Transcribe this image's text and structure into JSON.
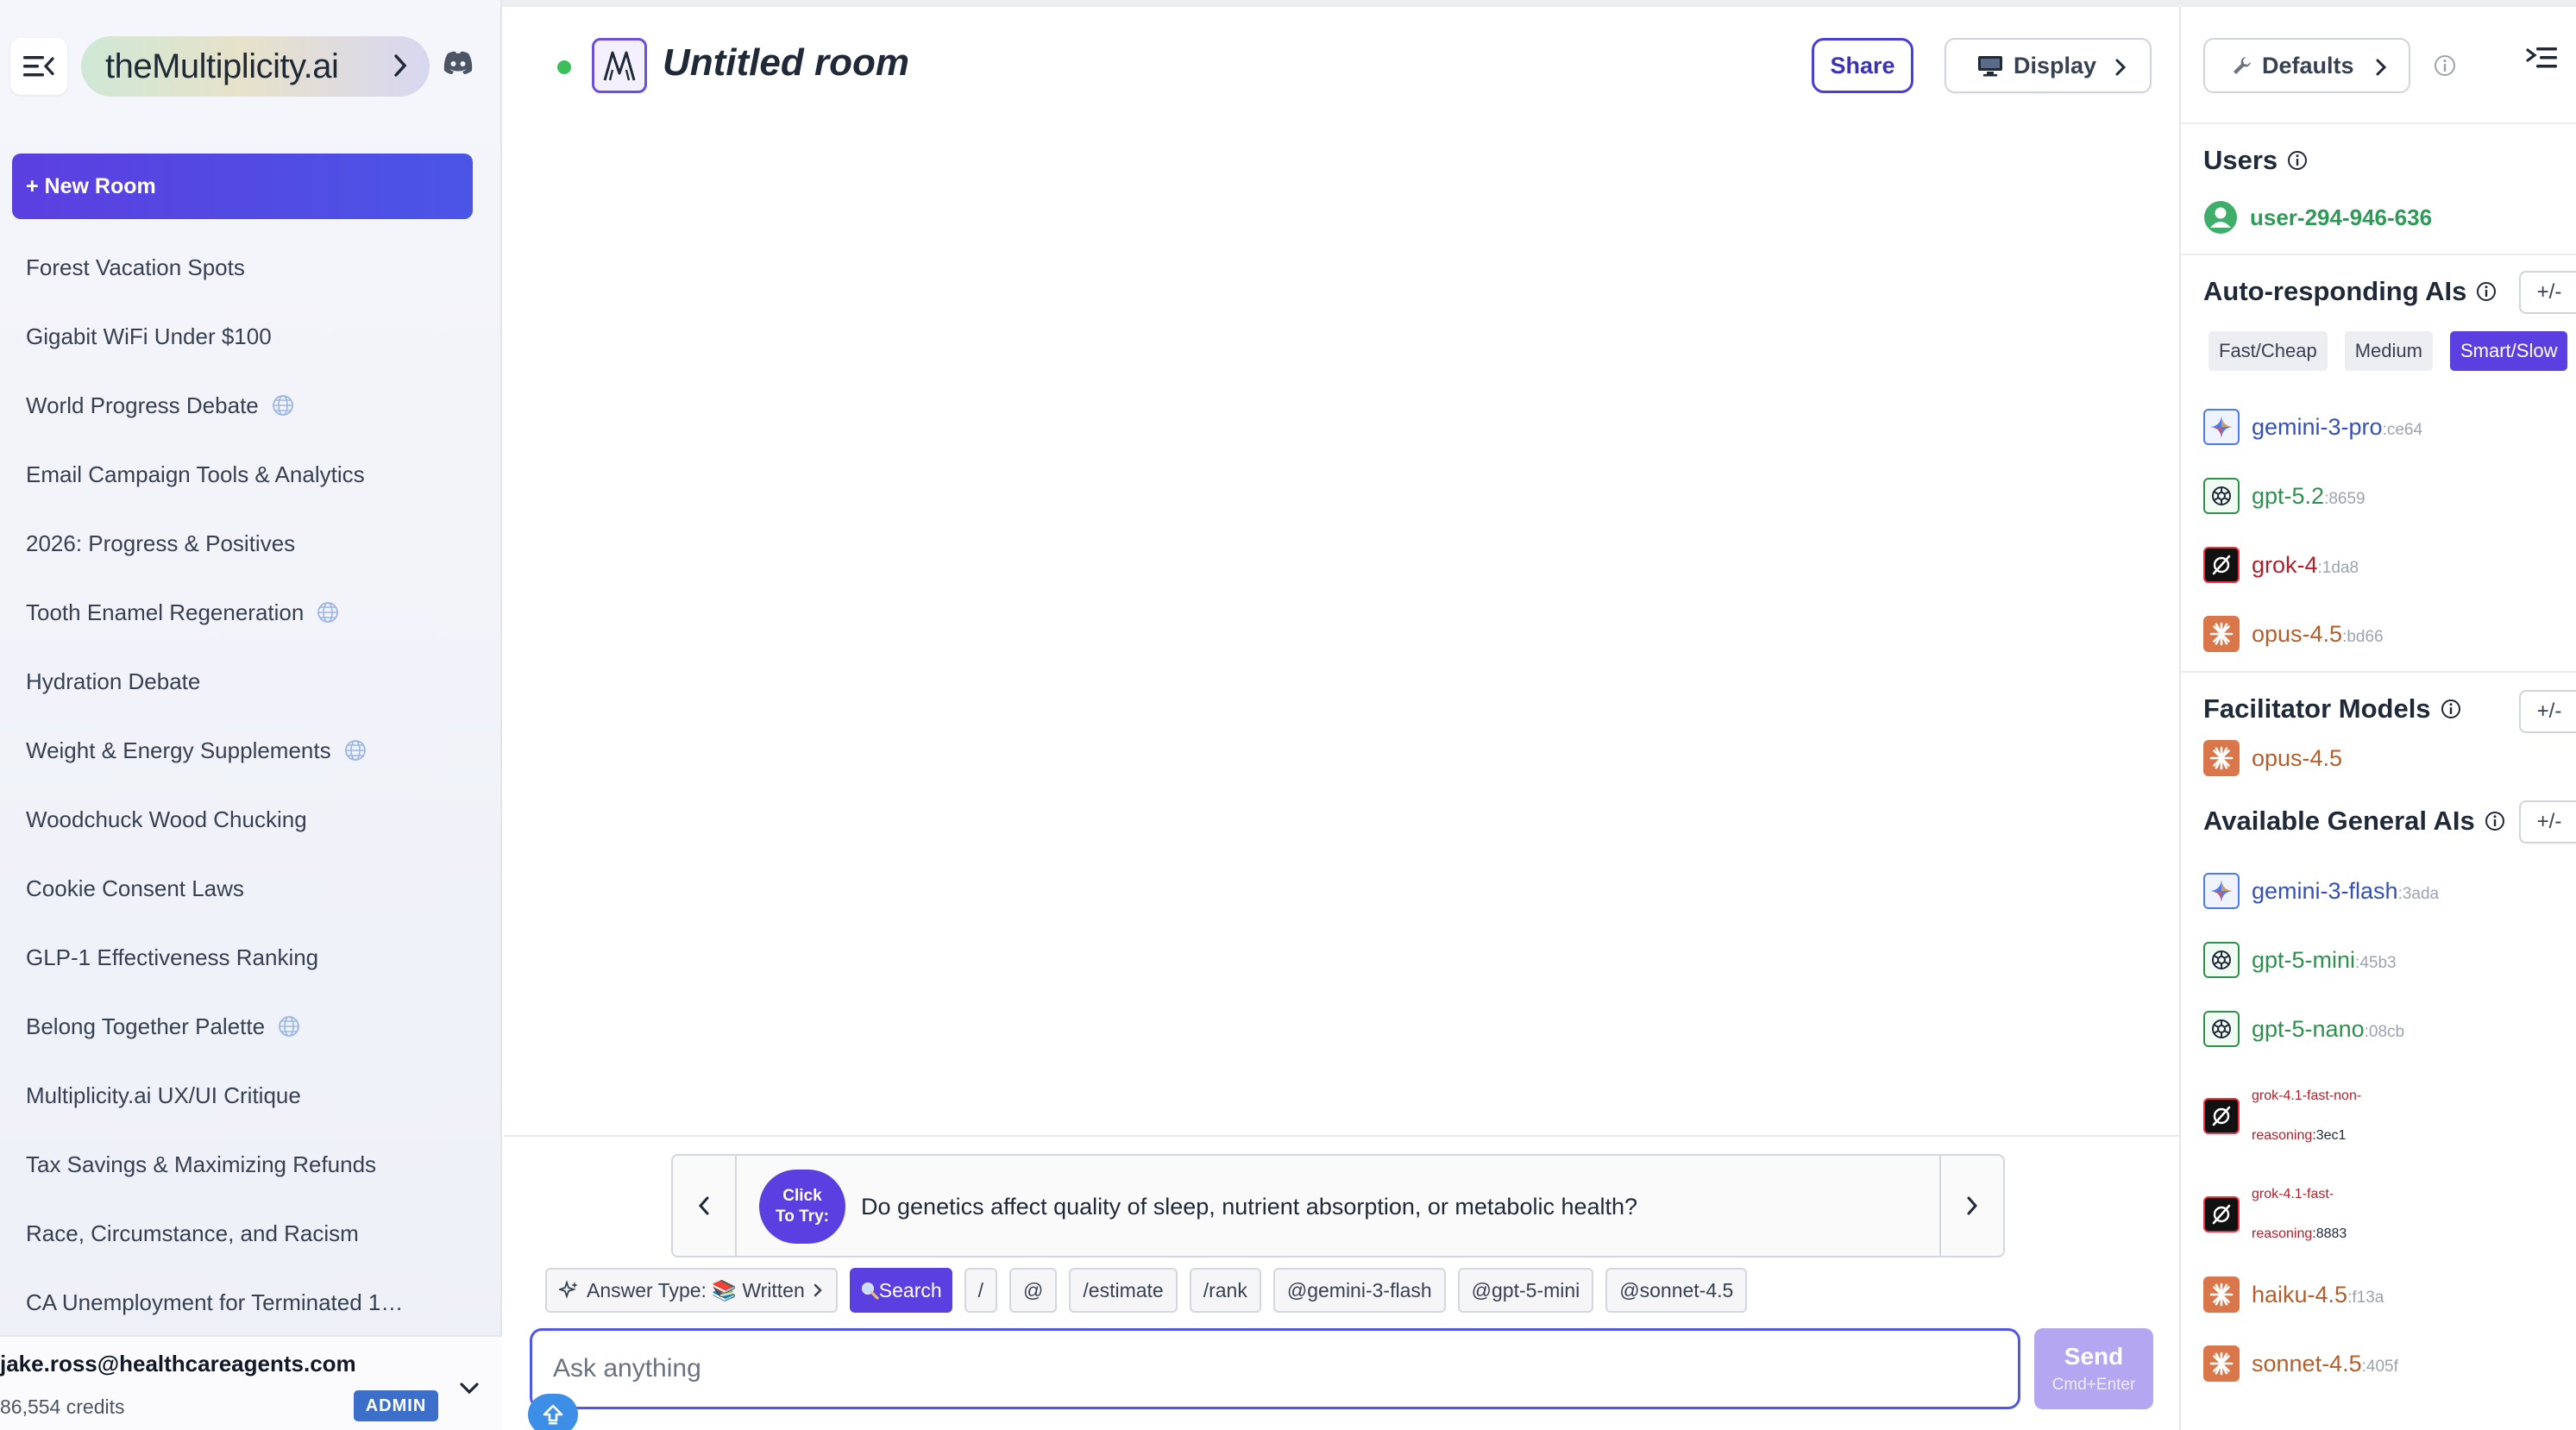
{
  "app": {
    "brand": "theMultiplicity.ai"
  },
  "sidebar": {
    "new_room_label": "+ New Room",
    "rooms": [
      {
        "label": "Forest Vacation Spots",
        "globe": false
      },
      {
        "label": "Gigabit WiFi Under $100",
        "globe": false
      },
      {
        "label": "World Progress Debate",
        "globe": true
      },
      {
        "label": "Email Campaign Tools & Analytics",
        "globe": false
      },
      {
        "label": "2026: Progress & Positives",
        "globe": false
      },
      {
        "label": "Tooth Enamel Regeneration",
        "globe": true
      },
      {
        "label": "Hydration Debate",
        "globe": false
      },
      {
        "label": "Weight & Energy Supplements",
        "globe": true
      },
      {
        "label": "Woodchuck Wood Chucking",
        "globe": false
      },
      {
        "label": "Cookie Consent Laws",
        "globe": false
      },
      {
        "label": "GLP-1 Effectiveness Ranking",
        "globe": false
      },
      {
        "label": "Belong Together Palette",
        "globe": true
      },
      {
        "label": "Multiplicity.ai UX/UI Critique",
        "globe": false
      },
      {
        "label": "Tax Savings & Maximizing Refunds",
        "globe": false
      },
      {
        "label": "Race, Circumstance, and Racism",
        "globe": false
      },
      {
        "label": "CA Unemployment for Terminated 1…",
        "globe": false
      }
    ],
    "account": {
      "email": "jake.ross@healthcareagents.com",
      "credits": "86,554 credits",
      "role_badge": "ADMIN"
    }
  },
  "main": {
    "room_title": "Untitled room",
    "share_label": "Share",
    "display_label": "Display",
    "suggestion": {
      "badge_line1": "Click",
      "badge_line2": "To Try:",
      "text": "Do genetics affect quality of sleep, nutrient absorption, or metabolic health?"
    },
    "chips": {
      "answer_type": "Answer Type: 📚 Written",
      "search": "Search",
      "slash": "/",
      "at": "@",
      "estimate": "/estimate",
      "rank": "/rank",
      "gemini_flash": "@gemini-3-flash",
      "gpt_mini": "@gpt-5-mini",
      "sonnet": "@sonnet-4.5"
    },
    "input_placeholder": "Ask anything",
    "send_label": "Send",
    "send_hint": "Cmd+Enter"
  },
  "right_panel": {
    "defaults_label": "Defaults",
    "users_title": "Users",
    "user": "user-294-946-636",
    "auto_title": "Auto-responding AIs",
    "plus_minus": "+/-",
    "tiers": [
      "Fast/Cheap",
      "Medium",
      "Smart/Slow"
    ],
    "active_tier": "Smart/Slow",
    "auto_models": [
      {
        "name": "gemini-3-pro",
        "id": ":ce64",
        "vendor": "gemini"
      },
      {
        "name": "gpt-5.2",
        "id": ":8659",
        "vendor": "gpt"
      },
      {
        "name": "grok-4",
        "id": ":1da8",
        "vendor": "grok"
      },
      {
        "name": "opus-4.5",
        "id": ":bd66",
        "vendor": "claude"
      }
    ],
    "facilitator_title": "Facilitator Models",
    "facilitator_model": "opus-4.5",
    "general_title": "Available General AIs",
    "general_models": [
      {
        "name": "gemini-3-flash",
        "id": ":3ada",
        "vendor": "gemini"
      },
      {
        "name": "gpt-5-mini",
        "id": ":45b3",
        "vendor": "gpt"
      },
      {
        "name": "gpt-5-nano",
        "id": ":08cb",
        "vendor": "gpt"
      },
      {
        "name_line1": "grok-4.1-fast-non-",
        "name_line2": "reasoning",
        "id": ":3ec1",
        "vendor": "grok"
      },
      {
        "name_line1": "grok-4.1-fast-",
        "name_line2": "reasoning",
        "id": ":8883",
        "vendor": "grok"
      },
      {
        "name": "haiku-4.5",
        "id": ":f13a",
        "vendor": "claude"
      },
      {
        "name": "sonnet-4.5",
        "id": ":405f",
        "vendor": "claude"
      }
    ]
  },
  "colors": {
    "accent": "#5b3fe0",
    "status_online": "#3cbf5b",
    "user_green": "#2f9a57",
    "admin_badge": "#3b6fc9"
  },
  "icons": {
    "menu": "menu-collapse-icon",
    "discord": "discord-icon",
    "globe": "globe-icon",
    "display": "monitor-icon",
    "defaults": "wrench-icon",
    "info": "info-icon",
    "upload": "upload-icon",
    "sparkle": "sparkle-icon",
    "search": "magnifier-icon"
  }
}
